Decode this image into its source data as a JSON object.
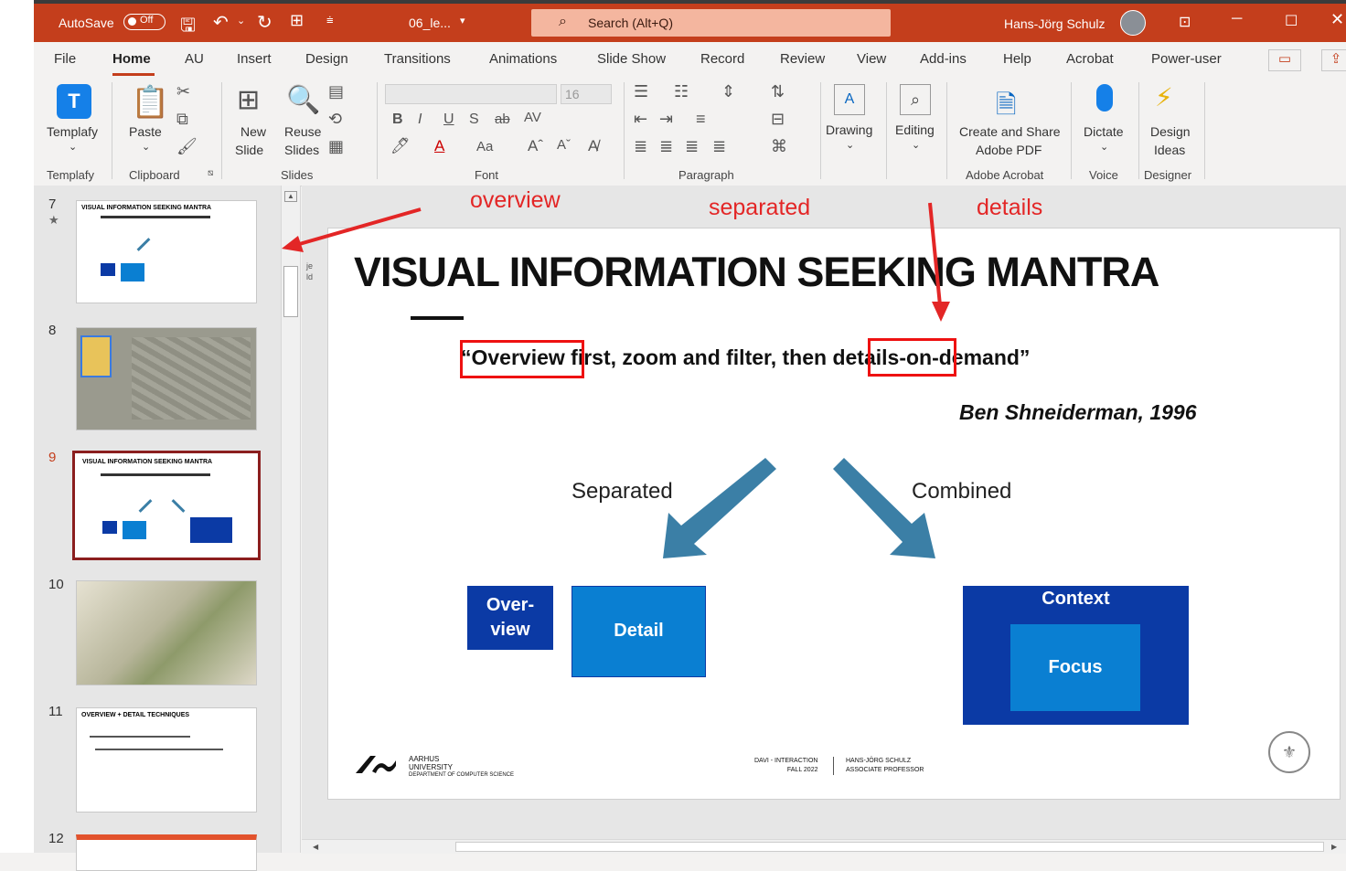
{
  "titlebar": {
    "autosave_label": "AutoSave",
    "autosave_state": "Off",
    "filename": "06_le...",
    "search_placeholder": "Search (Alt+Q)",
    "user_name": "Hans-Jörg Schulz"
  },
  "menu": {
    "tabs": [
      "File",
      "Home",
      "AU",
      "Insert",
      "Design",
      "Transitions",
      "Animations",
      "Slide Show",
      "Record",
      "Review",
      "View",
      "Add-ins",
      "Help",
      "Acrobat",
      "Power-user"
    ],
    "active": "Home"
  },
  "ribbon": {
    "templafy": "Templafy",
    "paste": "Paste",
    "new_slide": [
      "New",
      "Slide"
    ],
    "reuse_slides": [
      "Reuse",
      "Slides"
    ],
    "font_size": "16",
    "drawing": "Drawing",
    "editing": "Editing",
    "create_share": [
      "Create and Share",
      "Adobe PDF"
    ],
    "dictate": "Dictate",
    "design_ideas": [
      "Design",
      "Ideas"
    ],
    "groups": {
      "templafy": "Templafy",
      "clipboard": "Clipboard",
      "slides": "Slides",
      "font": "Font",
      "paragraph": "Paragraph",
      "adobe": "Adobe Acrobat",
      "voice": "Voice",
      "designer": "Designer"
    }
  },
  "thumbnails": [
    {
      "num": "7",
      "title": "VISUAL INFORMATION SEEKING MANTRA",
      "starred": true
    },
    {
      "num": "8",
      "title": ""
    },
    {
      "num": "9",
      "title": "VISUAL INFORMATION SEEKING MANTRA",
      "selected": true
    },
    {
      "num": "10",
      "title": ""
    },
    {
      "num": "11",
      "title": "OVERVIEW + DETAIL TECHNIQUES"
    },
    {
      "num": "12",
      "title": ""
    }
  ],
  "slide": {
    "title": "VISUAL INFORMATION SEEKING MANTRA",
    "quote_open": "“",
    "quote_word1": "Overview",
    "quote_mid": " first, zoom and filter, then ",
    "quote_word2": "details",
    "quote_end": "-on-demand”",
    "author": "Ben Shneiderman, 1996",
    "separated_label": "Separated",
    "combined_label": "Combined",
    "overview_box": [
      "Over-",
      "view"
    ],
    "detail_box": "Detail",
    "context_box": "Context",
    "focus_box": "Focus",
    "footer_university": [
      "AARHUS",
      "UNIVERSITY",
      "DEPARTMENT OF COMPUTER SCIENCE"
    ],
    "footer_course": [
      "DAVI - INTERACTION",
      "FALL 2022"
    ],
    "footer_person": [
      "HANS-JÖRG SCHULZ",
      "ASSOCIATE PROFESSOR"
    ]
  },
  "annotations": {
    "overview": "overview",
    "separated": "separated",
    "details": "details"
  },
  "colors": {
    "accent": "#c43e1c",
    "dark_blue": "#0b3aa5",
    "mid_blue": "#0a7fd2",
    "arrow_blue": "#3b7fa6",
    "annotation_red": "#e32626"
  }
}
